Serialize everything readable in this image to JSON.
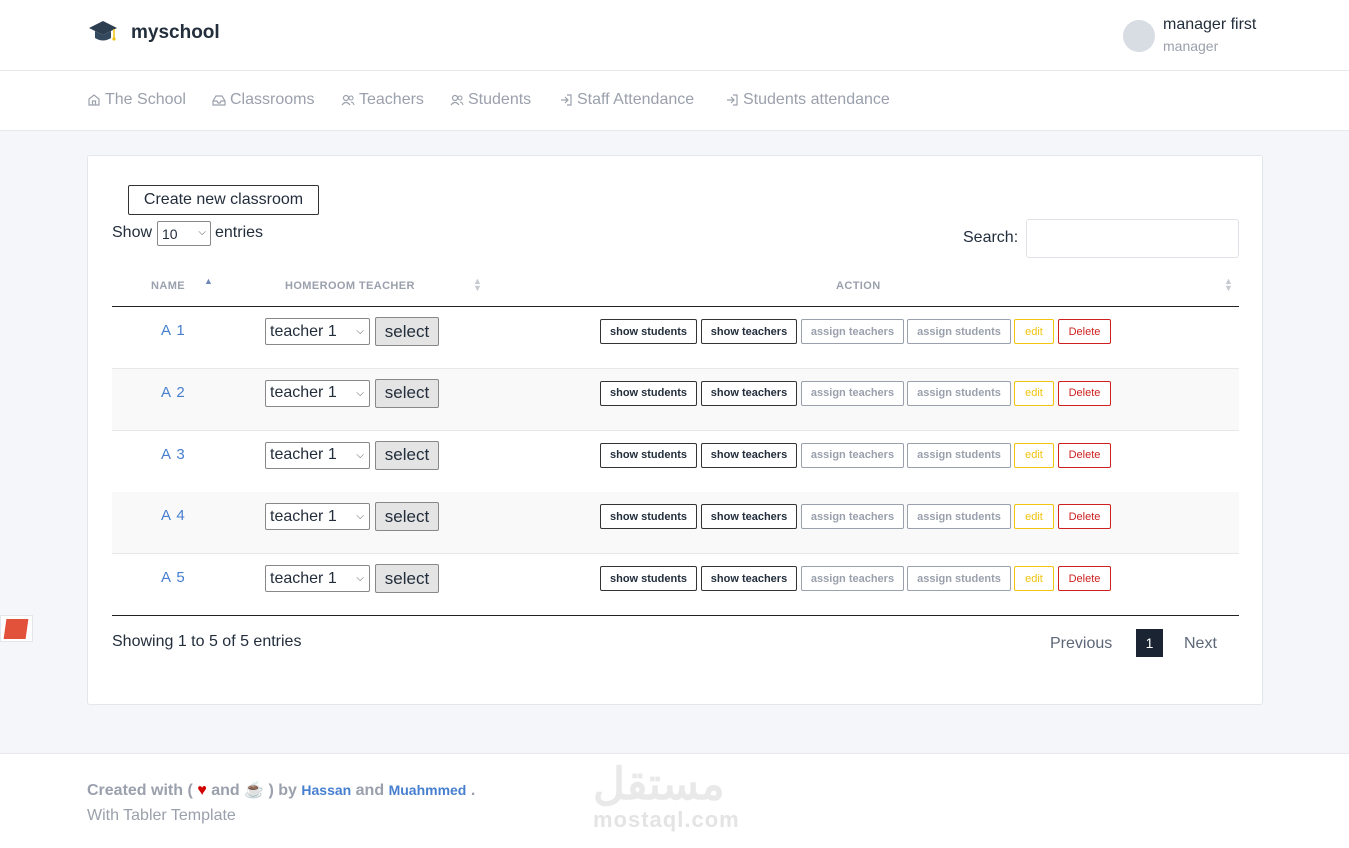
{
  "brand": {
    "name": "myschool"
  },
  "user": {
    "name": "manager first",
    "role": "manager"
  },
  "nav": [
    {
      "label": "The School",
      "icon": "home-icon"
    },
    {
      "label": "Classrooms",
      "icon": "inbox-icon"
    },
    {
      "label": "Teachers",
      "icon": "users-icon"
    },
    {
      "label": "Students",
      "icon": "users-icon"
    },
    {
      "label": "Staff Attendance",
      "icon": "log-in-icon"
    },
    {
      "label": "Students attendance",
      "icon": "log-in-icon"
    }
  ],
  "table": {
    "create_label": "Create new classroom",
    "show_label": "Show",
    "entries_value": "10",
    "entries_label": "entries",
    "search_label": "Search:",
    "search_value": "",
    "headers": [
      "NAME",
      "HOMEROOM TEACHER",
      "ACTION"
    ],
    "select_button_label": "select",
    "actions": [
      "show students",
      "show teachers",
      "assign teachers",
      "assign students",
      "edit",
      "Delete"
    ],
    "rows": [
      {
        "name": "A 1",
        "teacher": "teacher 1"
      },
      {
        "name": "A 2",
        "teacher": "teacher 1"
      },
      {
        "name": "A 3",
        "teacher": "teacher 1"
      },
      {
        "name": "A 4",
        "teacher": "teacher 1"
      },
      {
        "name": "A 5",
        "teacher": "teacher 1"
      }
    ],
    "info": "Showing 1 to 5 of 5 entries",
    "pagination": {
      "prev": "Previous",
      "current": "1",
      "next": "Next"
    }
  },
  "footer": {
    "created_with": "Created with (",
    "and1": "and",
    "by": ") by",
    "author1": "Hassan",
    "and2": "and",
    "author2": "Muahmmed",
    "period": ".",
    "template": "With Tabler Template"
  },
  "watermark": {
    "arabic": "مستقل",
    "latin": "mostaql.com"
  },
  "colors": {
    "link": "#467fcf",
    "muted": "#9aa0ac",
    "danger": "#cd201f",
    "warning": "#f1c40f",
    "active_page": "#1b2432"
  }
}
